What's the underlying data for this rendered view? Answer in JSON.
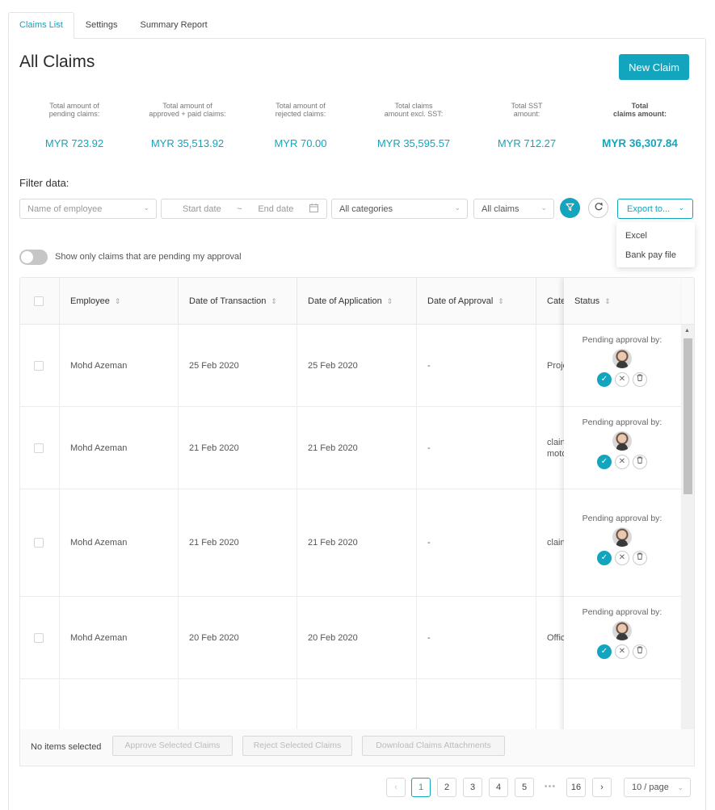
{
  "tabs": [
    {
      "label": "Claims List"
    },
    {
      "label": "Settings"
    },
    {
      "label": "Summary Report"
    }
  ],
  "page": {
    "title": "All Claims",
    "new_claim_label": "New Claim"
  },
  "stats": [
    {
      "label_line1": "Total amount of",
      "label_line2": "pending claims:",
      "value": "MYR 723.92"
    },
    {
      "label_line1": "Total amount of",
      "label_line2": "approved + paid claims:",
      "value": "MYR 35,513.92"
    },
    {
      "label_line1": "Total amount of",
      "label_line2": "rejected claims:",
      "value": "MYR 70.00"
    },
    {
      "label_line1": "Total claims",
      "label_line2": "amount excl. SST:",
      "value": "MYR 35,595.57"
    },
    {
      "label_line1": "Total SST",
      "label_line2": "amount:",
      "value": "MYR 712.27"
    },
    {
      "label_line1": "Total",
      "label_line2": "claims amount:",
      "value": "MYR 36,307.84"
    }
  ],
  "filters": {
    "label": "Filter data:",
    "employee_placeholder": "Name of employee",
    "start_date_placeholder": "Start date",
    "date_separator": "~",
    "end_date_placeholder": "End date",
    "category": "All categories",
    "claim_scope": "All claims",
    "export_label": "Export to...",
    "export_options": [
      "Excel",
      "Bank pay file"
    ]
  },
  "toggle": {
    "label": "Show only claims that are pending my approval",
    "on": false
  },
  "table": {
    "columns": [
      "Employee",
      "Date of Transaction",
      "Date of Application",
      "Date of Approval",
      "Category",
      "Status"
    ],
    "category_header_visible": "Cate",
    "rows": [
      {
        "employee": "Mohd Azeman",
        "transaction": "25 Feb 2020",
        "application": "25 Feb 2020",
        "approval": "-",
        "category": "Proje",
        "status": "Pending approval by:"
      },
      {
        "employee": "Mohd Azeman",
        "transaction": "21 Feb 2020",
        "application": "21 Feb 2020",
        "approval": "-",
        "category_line1": "clain",
        "category_line2": "moto",
        "status": "Pending approval by:"
      },
      {
        "employee": "Mohd Azeman",
        "transaction": "21 Feb 2020",
        "application": "21 Feb 2020",
        "approval": "-",
        "category": "clain",
        "status": "Pending approval by:"
      },
      {
        "employee": "Mohd Azeman",
        "transaction": "20 Feb 2020",
        "application": "20 Feb 2020",
        "approval": "-",
        "category": "Offic",
        "status": "Pending approval by:"
      }
    ]
  },
  "footer": {
    "selection_text": "No items selected",
    "approve_label": "Approve Selected Claims",
    "reject_label": "Reject Selected Claims",
    "download_label": "Download Claims Attachments"
  },
  "pagination": {
    "pages": [
      "1",
      "2",
      "3",
      "4",
      "5"
    ],
    "ellipsis": "•••",
    "last_page": "16",
    "current": "1",
    "page_size": "10 / page"
  },
  "colors": {
    "accent": "#13a5bd"
  }
}
